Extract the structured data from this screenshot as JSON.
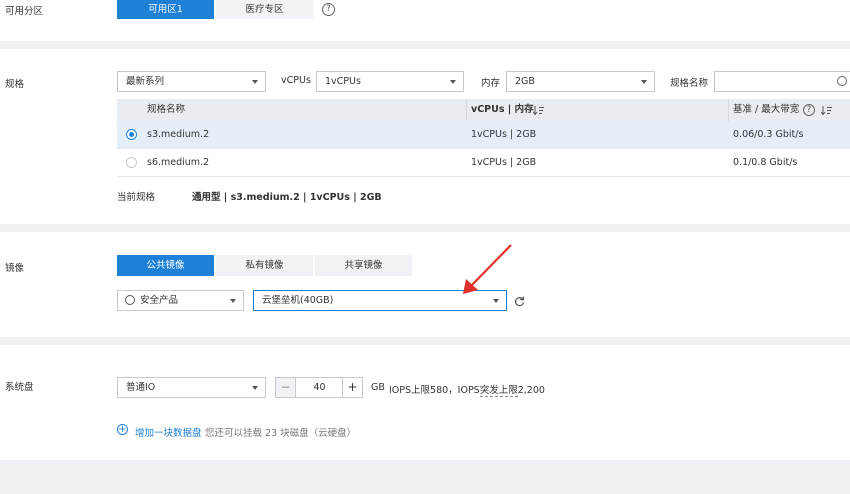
{
  "az": {
    "label": "可用分区",
    "options": [
      "可用区1",
      "医疗专区"
    ]
  },
  "spec": {
    "label": "规格",
    "series_select": "最新系列",
    "vcpu_label": "vCPUs",
    "vcpu_value": "1vCPUs",
    "mem_label": "内存",
    "mem_value": "2GB",
    "name_label": "规格名称",
    "name_placeholder": "",
    "table": {
      "headers": [
        "规格名称",
        "vCPUs | 内存",
        "基准 / 最大带宽"
      ],
      "rows": [
        {
          "name": "s3.medium.2",
          "cpu_mem": "1vCPUs | 2GB",
          "bandwidth": "0.06/0.3 Gbit/s",
          "selected": true
        },
        {
          "name": "s6.medium.2",
          "cpu_mem": "1vCPUs | 2GB",
          "bandwidth": "0.1/0.8 Gbit/s",
          "selected": false
        }
      ]
    },
    "current_label": "当前规格",
    "current_value": "通用型 | s3.medium.2 | 1vCPUs | 2GB"
  },
  "image": {
    "label": "镜像",
    "tabs": [
      "公共镜像",
      "私有镜像",
      "共享镜像"
    ],
    "category_select": "安全产品",
    "image_select": "云堡垒机(40GB)"
  },
  "disk": {
    "label": "系统盘",
    "type_select": "普通IO",
    "size": "40",
    "unit": "GB",
    "iops_prefix": "IOPS上限580，IOPS",
    "iops_burst": "突发上限",
    "iops_value": "2,200",
    "add_label": "增加一块数据盘",
    "add_hint": "您还可以挂载 23 块磁盘（云硬盘）"
  },
  "colors": {
    "accent": "#1f80d8",
    "annotation_arrow": "#e0302a"
  }
}
